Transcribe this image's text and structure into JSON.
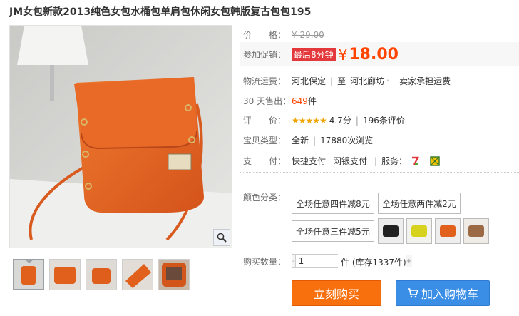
{
  "title": "JM女包新款2013纯色女包水桶包单肩包休闲女包韩版复古包包195",
  "price_row": {
    "label": "价　　格：",
    "original": "¥ 29.00"
  },
  "promo_row": {
    "label": "参加促销：",
    "tag": "最后8分钟",
    "yen": "¥",
    "price": "18.00"
  },
  "shipping_row": {
    "label": "物流运费：",
    "from": "河北保定",
    "sep": "|",
    "to_prefix": "至",
    "to": "河北廊坊",
    "note": "卖家承担运费"
  },
  "sales_row": {
    "label": "30 天售出：",
    "count": "649",
    "unit": "件"
  },
  "rating_row": {
    "label": "评　　价：",
    "stars": "★★★★★",
    "score": "4.7分",
    "sep": "|",
    "reviews": "196条评价"
  },
  "type_row": {
    "label": "宝贝类型：",
    "type": "全新",
    "sep": "|",
    "views": "17880次浏览"
  },
  "pay_row": {
    "label": "支　　付：",
    "method1": "快捷支付",
    "method2": "网银支付",
    "sep": "|",
    "service_label": "服务："
  },
  "color_row": {
    "label": "颜色分类：",
    "options": [
      "全场任意四件减8元",
      "全场任意两件减2元",
      "全场任意三件减5元"
    ],
    "swatches": [
      "black-bag",
      "yellow-bag",
      "orange-bag",
      "brown-bag"
    ]
  },
  "qty_row": {
    "label": "购买数量：",
    "value": "1",
    "unit": "件 (库存1337件)"
  },
  "buttons": {
    "buy": "立刻购买",
    "cart": "加入购物车"
  },
  "colors": {
    "accent": "#ff4400",
    "buy_button": "#f86f0e",
    "cart_button": "#3a8ee6",
    "bag": "#e0601c"
  },
  "icons": {
    "zoom": "magnifier-icon",
    "cart": "cart-icon",
    "service1": "seven-day-return-icon",
    "service2": "quality-icon"
  }
}
